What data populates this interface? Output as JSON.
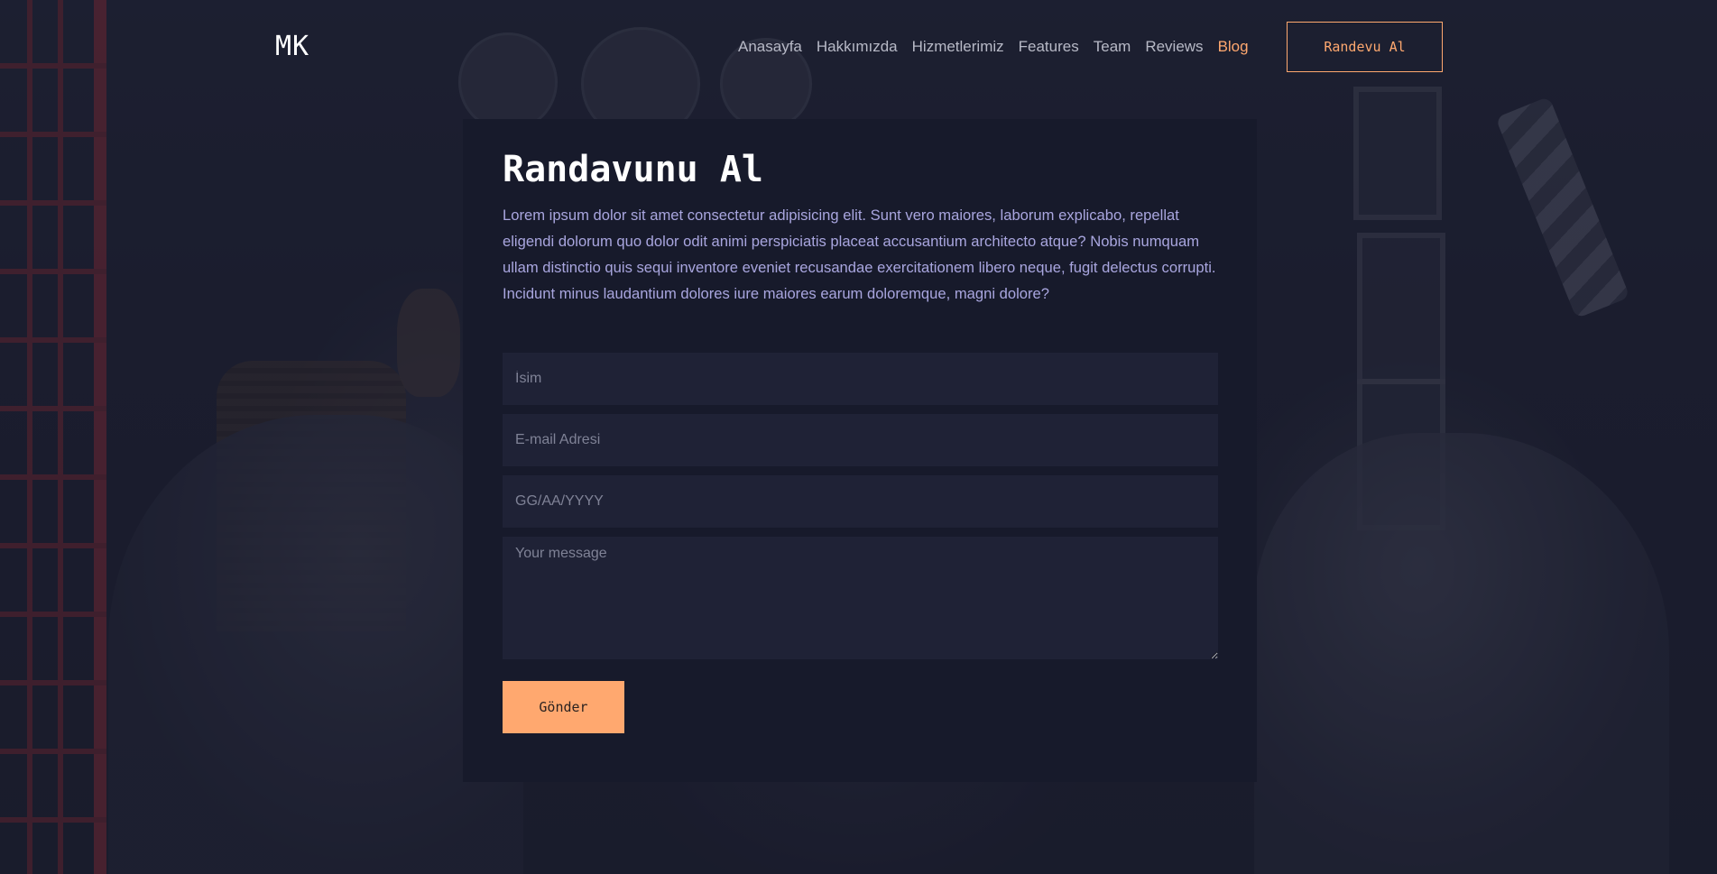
{
  "header": {
    "logo": "MK",
    "nav": [
      {
        "label": "Anasayfa",
        "active": false
      },
      {
        "label": "Hakkımızda",
        "active": false
      },
      {
        "label": "Hizmetlerimiz",
        "active": false
      },
      {
        "label": "Features",
        "active": false
      },
      {
        "label": "Team",
        "active": false
      },
      {
        "label": "Reviews",
        "active": false
      },
      {
        "label": "Blog",
        "active": true
      }
    ],
    "cta_label": "Randevu Al"
  },
  "form": {
    "title": "Randavunu Al",
    "description": "Lorem ipsum dolor sit amet consectetur adipisicing elit. Sunt vero maiores, laborum explicabo, repellat eligendi dolorum quo dolor odit animi perspiciatis placeat accusantium architecto atque? Nobis numquam ullam distinctio quis sequi inventore eveniet recusandae exercitationem libero neque, fugit delectus corrupti. Incidunt minus laudantium dolores iure maiores earum doloremque, magni dolore?",
    "name_placeholder": "İsim",
    "email_placeholder": "E-mail Adresi",
    "date_placeholder": "GG/AA/YYYY",
    "message_placeholder": "Your message",
    "submit_label": "Gönder"
  },
  "colors": {
    "accent": "#ffa86f",
    "card_bg": "#171a2b",
    "field_bg": "#1f2236",
    "text_lavender": "#a9a6df"
  }
}
